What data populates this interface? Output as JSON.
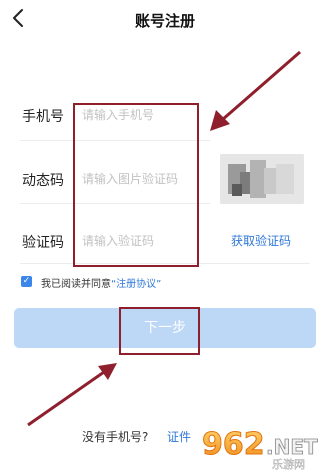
{
  "header": {
    "title": "账号注册",
    "back_icon": "chevron-left-icon"
  },
  "form": {
    "phone": {
      "label": "手机号",
      "placeholder": "请输入手机号",
      "value": ""
    },
    "dynamic_code": {
      "label": "动态码",
      "placeholder": "请输入图片验证码",
      "value": ""
    },
    "verify_code": {
      "label": "验证码",
      "placeholder": "请输入验证码",
      "value": "",
      "action_label": "获取验证码"
    }
  },
  "agreement": {
    "checked": true,
    "text": "我已阅读并同意",
    "link": "“注册协议”"
  },
  "next_button": {
    "label": "下一步"
  },
  "footer": {
    "text": "没有手机号?",
    "link": "证件"
  },
  "watermark": {
    "brand": "962",
    "suffix": ".NET",
    "sub": "乐游网"
  },
  "colors": {
    "accent": "#2f78d8",
    "button_disabled": "#bcd8f6",
    "annotation": "#8f1f2c"
  }
}
